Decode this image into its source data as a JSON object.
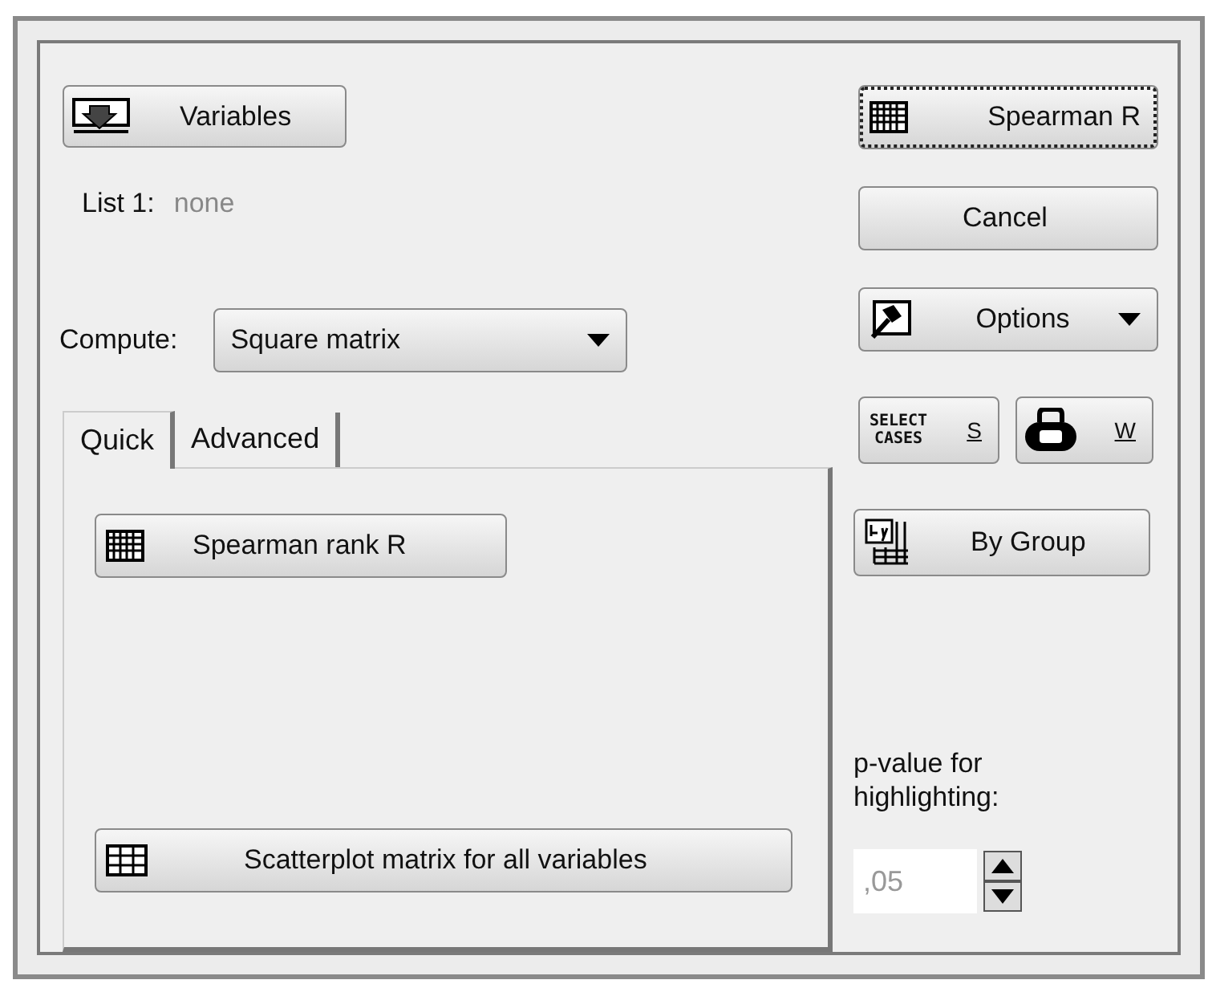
{
  "variables_button": {
    "label": "Variables"
  },
  "list_1": {
    "label": "List 1:",
    "value": "none"
  },
  "compute": {
    "label": "Compute:",
    "value": "Square matrix"
  },
  "tabs": [
    {
      "label": "Quick",
      "selected": true
    },
    {
      "label": "Advanced",
      "selected": false
    }
  ],
  "quick_buttons": [
    {
      "label": "Spearman rank R",
      "kind": "grid"
    },
    {
      "label": "Scatterplot matrix for all variables",
      "kind": "scatter"
    }
  ],
  "side_buttons": [
    {
      "label": "Spearman R",
      "kind": "grid",
      "focused": true
    },
    {
      "label": "Cancel",
      "kind": "plain",
      "focused": false
    },
    {
      "label": "Options",
      "kind": "options",
      "focused": false
    }
  ],
  "small_buttons": [
    {
      "label": "SELECT CASES",
      "key": "S",
      "kind": "select"
    },
    {
      "label": "W",
      "kind": "weight"
    }
  ],
  "by_group_button": {
    "label": "By Group"
  },
  "p_value": {
    "label": "p-value for highlighting:",
    "value": ",05",
    "disabled": true
  }
}
